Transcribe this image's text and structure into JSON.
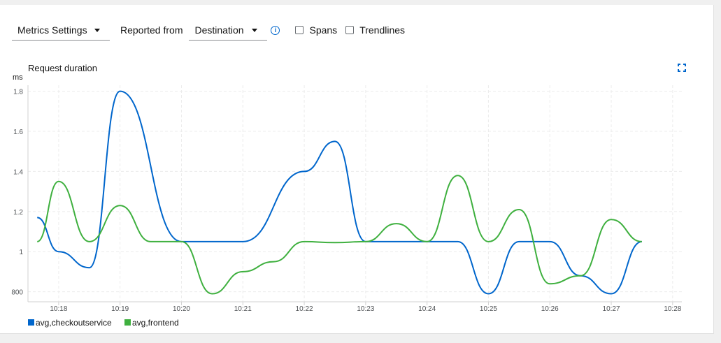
{
  "toolbar": {
    "metrics_settings": "Metrics Settings",
    "reported_from_label": "Reported from",
    "reported_from_value": "Destination",
    "spans_label": "Spans",
    "trendlines_label": "Trendlines",
    "spans_checked": false,
    "trendlines_checked": false
  },
  "chart": {
    "title": "Request duration",
    "expand_icon": "expand-icon",
    "info_icon": "info-icon"
  },
  "chart_data": {
    "type": "line",
    "title": "Request duration",
    "ylabel": "ms",
    "xlabel": "",
    "x_ticks": [
      "10:18",
      "10:19",
      "10:20",
      "10:21",
      "10:22",
      "10:23",
      "10:24",
      "10:25",
      "10:26",
      "10:27",
      "10:28"
    ],
    "y_ticks": [
      "800",
      "1",
      "1.2",
      "1.4",
      "1.6",
      "1.8"
    ],
    "y_tick_values": [
      0.8,
      1.0,
      1.2,
      1.4,
      1.6,
      1.8
    ],
    "xlim": [
      17.5,
      28.15
    ],
    "ylim": [
      0.75,
      1.83
    ],
    "grid": true,
    "legend_position": "bottom-left",
    "series": [
      {
        "name": "avg,checkoutservice",
        "color": "#0066cc",
        "x": [
          17.65,
          18.0,
          18.5,
          19.0,
          20.0,
          21.0,
          22.0,
          22.5,
          23.0,
          23.5,
          24.0,
          24.5,
          25.0,
          25.5,
          26.0,
          26.5,
          27.0,
          27.5
        ],
        "values": [
          1.17,
          1.0,
          0.92,
          1.8,
          1.05,
          1.05,
          1.4,
          1.55,
          1.05,
          1.05,
          1.05,
          1.05,
          0.79,
          1.05,
          1.05,
          0.88,
          0.79,
          1.05
        ]
      },
      {
        "name": "avg,frontend",
        "color": "#3fb03f",
        "x": [
          17.65,
          18.0,
          18.5,
          19.0,
          19.5,
          20.0,
          20.5,
          21.0,
          21.5,
          22.0,
          22.5,
          23.0,
          23.5,
          24.0,
          24.5,
          25.0,
          25.5,
          26.0,
          26.5,
          27.0,
          27.5
        ],
        "values": [
          1.05,
          1.35,
          1.05,
          1.23,
          1.05,
          1.05,
          0.79,
          0.9,
          0.95,
          1.05,
          1.045,
          1.05,
          1.14,
          1.05,
          1.38,
          1.05,
          1.21,
          0.84,
          0.88,
          1.16,
          1.05
        ]
      }
    ]
  }
}
